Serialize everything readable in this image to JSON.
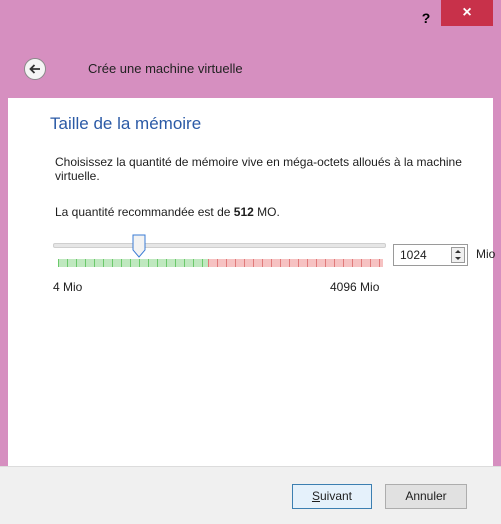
{
  "window": {
    "help_label": "?",
    "close_label": "×",
    "accent_color": "#d68fc0",
    "close_color": "#c8314a"
  },
  "header": {
    "back_icon": "back-arrow-icon",
    "title": "Crée une machine virtuelle"
  },
  "page": {
    "section_title": "Taille de la mémoire",
    "description": "Choisissez la quantité de mémoire vive en méga-octets alloués à la machine virtuelle.",
    "recommend_prefix": "La quantité recommandée est de ",
    "recommend_value": "512",
    "recommend_suffix": " MO."
  },
  "memory": {
    "slider_min_label": "4 Mio",
    "slider_max_label": "4096 Mio",
    "slider_min": 4,
    "slider_max": 4096,
    "value": "1024",
    "unit": "Mio"
  },
  "footer": {
    "next_underlined": "S",
    "next_rest": "uivant",
    "cancel_label": "Annuler"
  }
}
